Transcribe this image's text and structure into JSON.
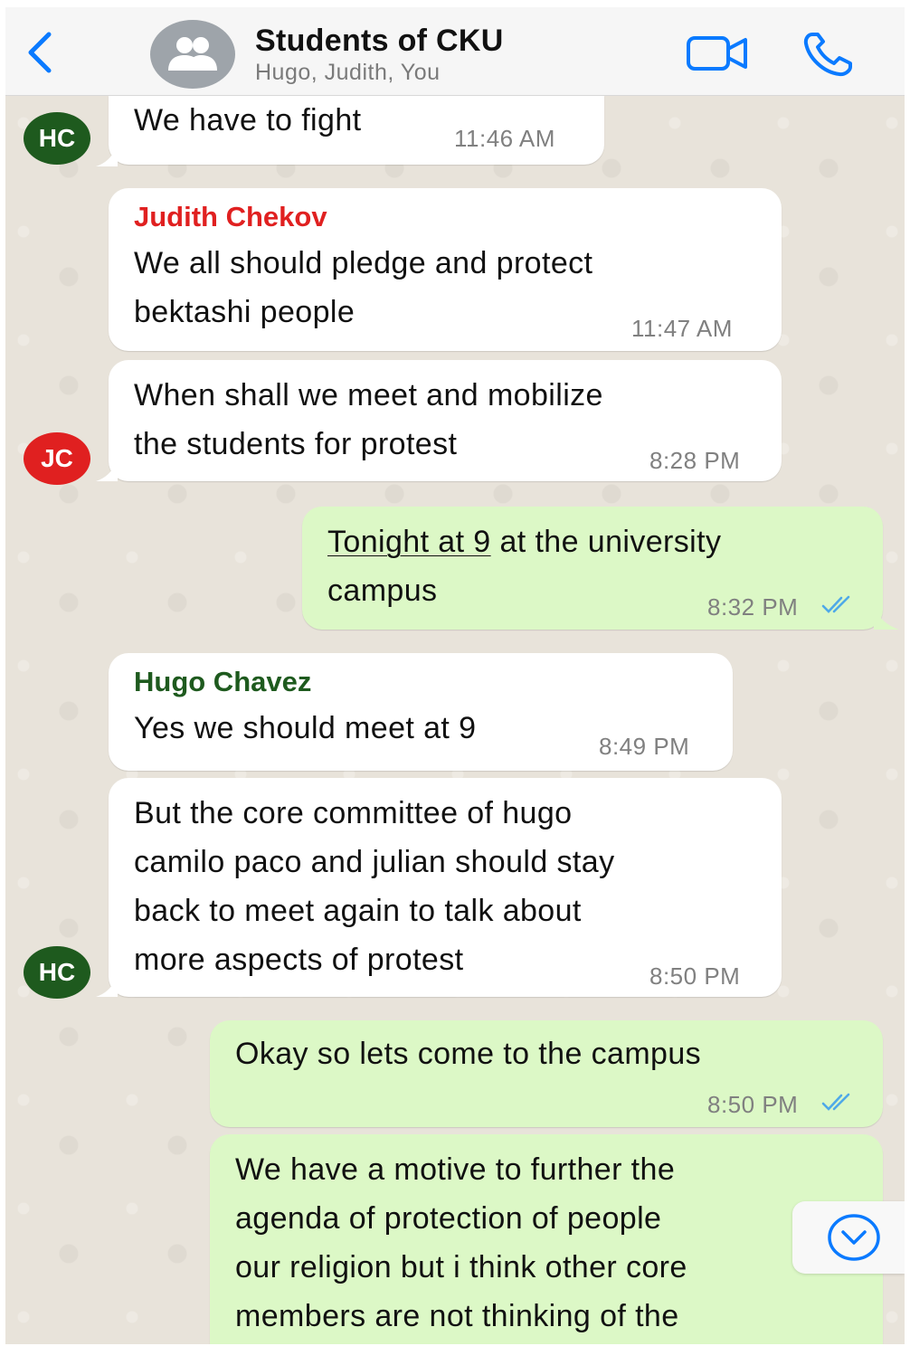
{
  "header": {
    "title": "Students of CKU",
    "subtitle": "Hugo, Judith, You",
    "icons": {
      "back": "chevron-left-icon",
      "group": "group-icon",
      "video": "video-camera-icon",
      "call": "phone-icon"
    }
  },
  "colors": {
    "accent": "#0a7aff",
    "incoming_bubble": "#ffffff",
    "outgoing_bubble": "#dcf8c6",
    "judith_name": "#e02020",
    "hugo_name": "#1e5a1e"
  },
  "messages": [
    {
      "avatar": "HC",
      "sender": "",
      "lines": [
        "We have to fight"
      ],
      "time": "11:46 AM"
    },
    {
      "avatar": "",
      "sender": "Judith Chekov",
      "lines": [
        "We all should pledge and protect",
        "bektashi people"
      ],
      "time": "11:47 AM"
    },
    {
      "avatar": "JC",
      "sender": "",
      "lines": [
        "When shall we meet and mobilize",
        "the students for protest"
      ],
      "time": "8:28 PM"
    },
    {
      "avatar": "",
      "sender": "",
      "lines_link": "Tonight at 9",
      "lines": [
        " at the university",
        "campus"
      ],
      "time": "8:32 PM",
      "status": "read"
    },
    {
      "avatar": "",
      "sender": "Hugo Chavez",
      "lines": [
        "Yes we should meet at 9"
      ],
      "time": "8:49 PM"
    },
    {
      "avatar": "HC",
      "sender": "",
      "lines": [
        "But the core committee of hugo",
        "camilo paco and julian should stay",
        "back to meet again to talk about",
        "more aspects of protest"
      ],
      "time": "8:50 PM"
    },
    {
      "avatar": "",
      "sender": "",
      "lines": [
        "Okay so lets come to the campus"
      ],
      "time": "8:50 PM",
      "status": "read"
    },
    {
      "avatar": "",
      "sender": "",
      "lines": [
        "We have a motive to further the",
        "agenda of protection of people",
        "our religion but i think other core",
        "members are not thinking of the"
      ],
      "time": ""
    }
  ],
  "scroll_button": {
    "icon": "chevron-down-circle-icon"
  }
}
